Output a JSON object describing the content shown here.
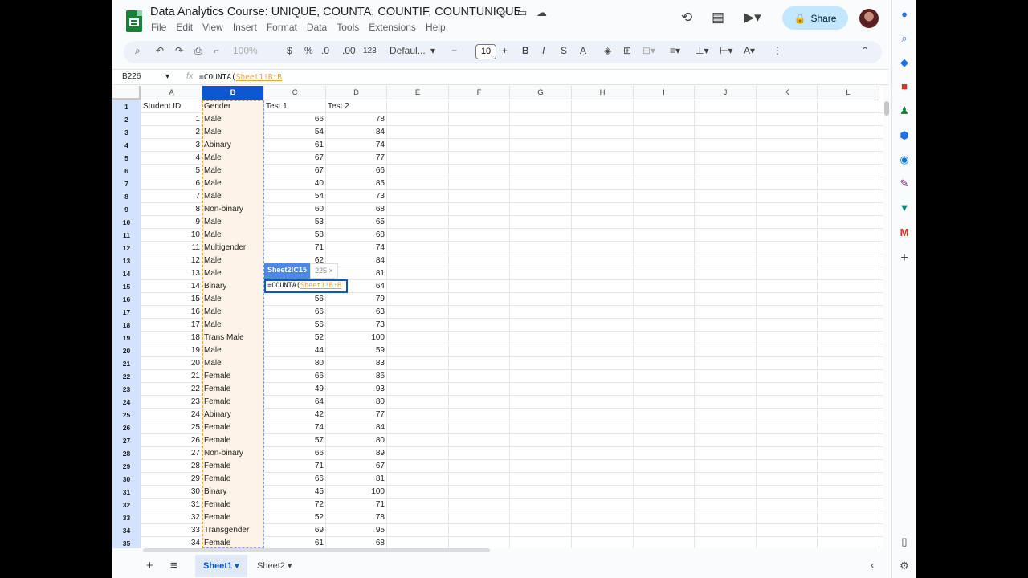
{
  "doc": {
    "title": "Data Analytics Course: UNIQUE, COUNTA, COUNTIF, COUNTUNIQUE",
    "menus": [
      "File",
      "Edit",
      "View",
      "Insert",
      "Format",
      "Data",
      "Tools",
      "Extensions",
      "Help"
    ],
    "share_label": "Share"
  },
  "toolbar": {
    "zoom": "100%",
    "currency": "$",
    "percent": "%",
    "dec_decrease": ".0",
    "dec_increase": ".00",
    "number_format": "123",
    "font": "Defaul...",
    "font_size": "10",
    "bold": "B",
    "italic": "I"
  },
  "formula_bar": {
    "cell_ref": "B226",
    "fx": "fx",
    "formula_prefix": "=COUNTA(",
    "formula_ref": "Sheet1!B:B"
  },
  "grid": {
    "columns": [
      "A",
      "B",
      "C",
      "D",
      "E",
      "F",
      "G",
      "H",
      "I",
      "J",
      "K",
      "L"
    ],
    "headers": [
      "Student ID",
      "Gender",
      "Test 1",
      "Test 2"
    ],
    "rows": [
      [
        "1",
        "Male",
        "66",
        "78"
      ],
      [
        "2",
        "Male",
        "54",
        "84"
      ],
      [
        "3",
        "Abinary",
        "61",
        "74"
      ],
      [
        "4",
        "Male",
        "67",
        "77"
      ],
      [
        "5",
        "Male",
        "67",
        "66"
      ],
      [
        "6",
        "Male",
        "40",
        "85"
      ],
      [
        "7",
        "Male",
        "54",
        "73"
      ],
      [
        "8",
        "Non-binary",
        "60",
        "68"
      ],
      [
        "9",
        "Male",
        "53",
        "65"
      ],
      [
        "10",
        "Male",
        "58",
        "68"
      ],
      [
        "11",
        "Multigender",
        "71",
        "74"
      ],
      [
        "12",
        "Male",
        "62",
        "84"
      ],
      [
        "13",
        "Male",
        "",
        "81"
      ],
      [
        "14",
        "Binary",
        "",
        "64"
      ],
      [
        "15",
        "Male",
        "56",
        "79"
      ],
      [
        "16",
        "Male",
        "66",
        "63"
      ],
      [
        "17",
        "Male",
        "56",
        "73"
      ],
      [
        "18",
        "Trans Male",
        "52",
        "100"
      ],
      [
        "19",
        "Male",
        "44",
        "59"
      ],
      [
        "20",
        "Male",
        "80",
        "83"
      ],
      [
        "21",
        "Female",
        "66",
        "86"
      ],
      [
        "22",
        "Female",
        "49",
        "93"
      ],
      [
        "23",
        "Female",
        "64",
        "80"
      ],
      [
        "24",
        "Abinary",
        "42",
        "77"
      ],
      [
        "25",
        "Female",
        "74",
        "84"
      ],
      [
        "26",
        "Female",
        "57",
        "80"
      ],
      [
        "27",
        "Non-binary",
        "66",
        "89"
      ],
      [
        "28",
        "Female",
        "71",
        "67"
      ],
      [
        "29",
        "Female",
        "66",
        "81"
      ],
      [
        "30",
        "Binary",
        "45",
        "100"
      ],
      [
        "31",
        "Female",
        "72",
        "71"
      ],
      [
        "32",
        "Female",
        "52",
        "78"
      ],
      [
        "33",
        "Transgender",
        "69",
        "95"
      ],
      [
        "34",
        "Female",
        "61",
        "68"
      ]
    ],
    "edit_cell": {
      "prefix": "=COUNTA(",
      "ref": "Sheet1!B:B"
    },
    "ref_tooltip": {
      "ref": "Sheet2!C15",
      "value": "225"
    }
  },
  "sheets": {
    "tabs": [
      "Sheet1",
      "Sheet2"
    ],
    "active": "Sheet1"
  },
  "colors": {
    "accent": "#0b57d0",
    "share_bg": "#c2e7ff",
    "range_fill": "#fdf3e7",
    "range_ref": "#e8a33d"
  }
}
